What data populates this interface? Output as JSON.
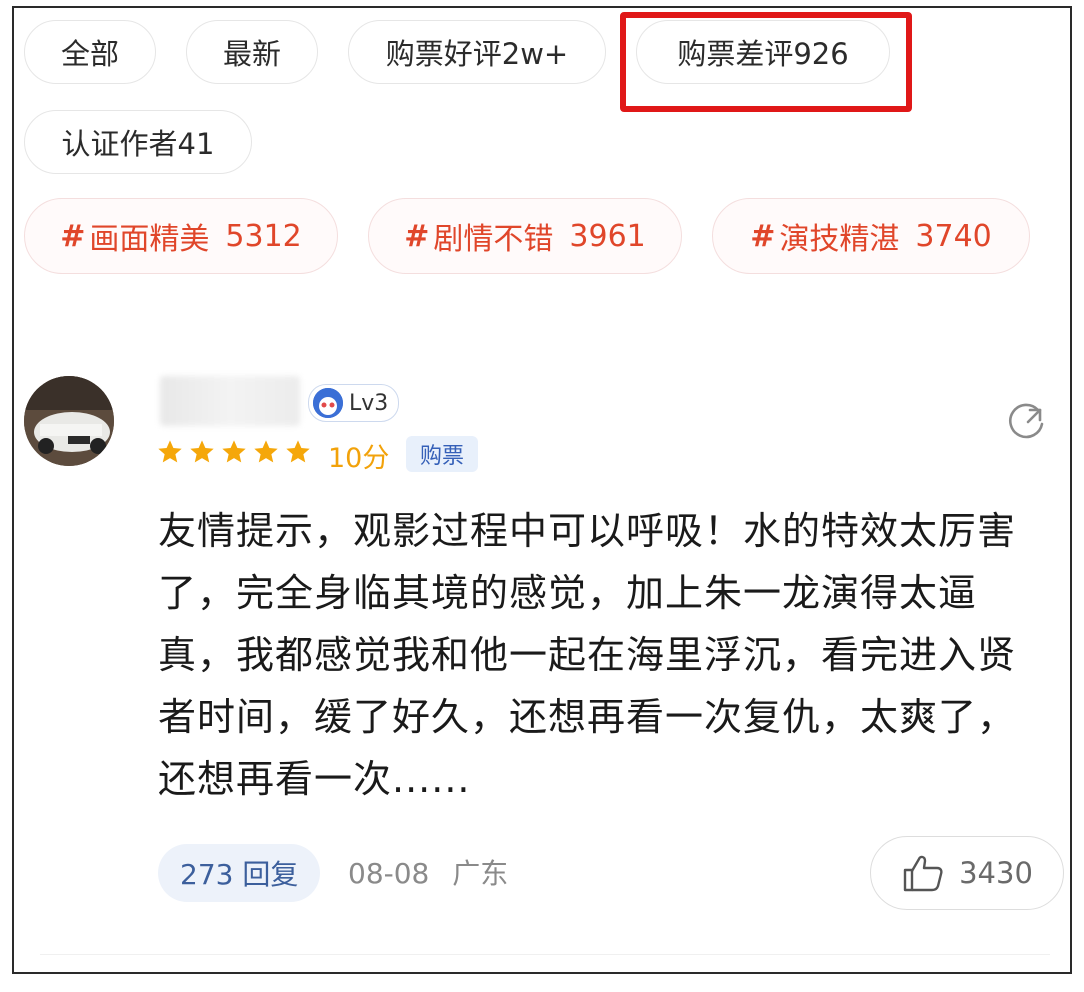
{
  "filters": {
    "all": "全部",
    "latest": "最新",
    "good_reviews": "购票好评2w+",
    "bad_reviews": "购票差评926",
    "verified_authors": "认证作者41"
  },
  "tags": [
    {
      "hash": "#",
      "label": "画面精美",
      "count": "5312"
    },
    {
      "hash": "#",
      "label": "剧情不错",
      "count": "3961"
    },
    {
      "hash": "#",
      "label": "演技精湛",
      "count": "3740"
    }
  ],
  "review": {
    "level": "Lv3",
    "stars": 5,
    "score": "10分",
    "badge": "购票",
    "text": "友情提示，观影过程中可以呼吸！水的特效太厉害了，完全身临其境的感觉，加上朱一龙演得太逼真，我都感觉我和他一起在海里浮沉，看完进入贤者时间，缓了好久，还想再看一次复仇，太爽了，还想再看一次......",
    "replies": "273 回复",
    "date": "08-08",
    "location": "广东",
    "likes": "3430"
  },
  "colors": {
    "tag_red": "#e0462a",
    "star_gold": "#f2a20a",
    "highlight_red": "#e01818",
    "reply_blue": "#3c5f9c"
  },
  "icons": [
    "star-icon",
    "share-icon",
    "thumbs-up-icon",
    "level-face-icon"
  ]
}
